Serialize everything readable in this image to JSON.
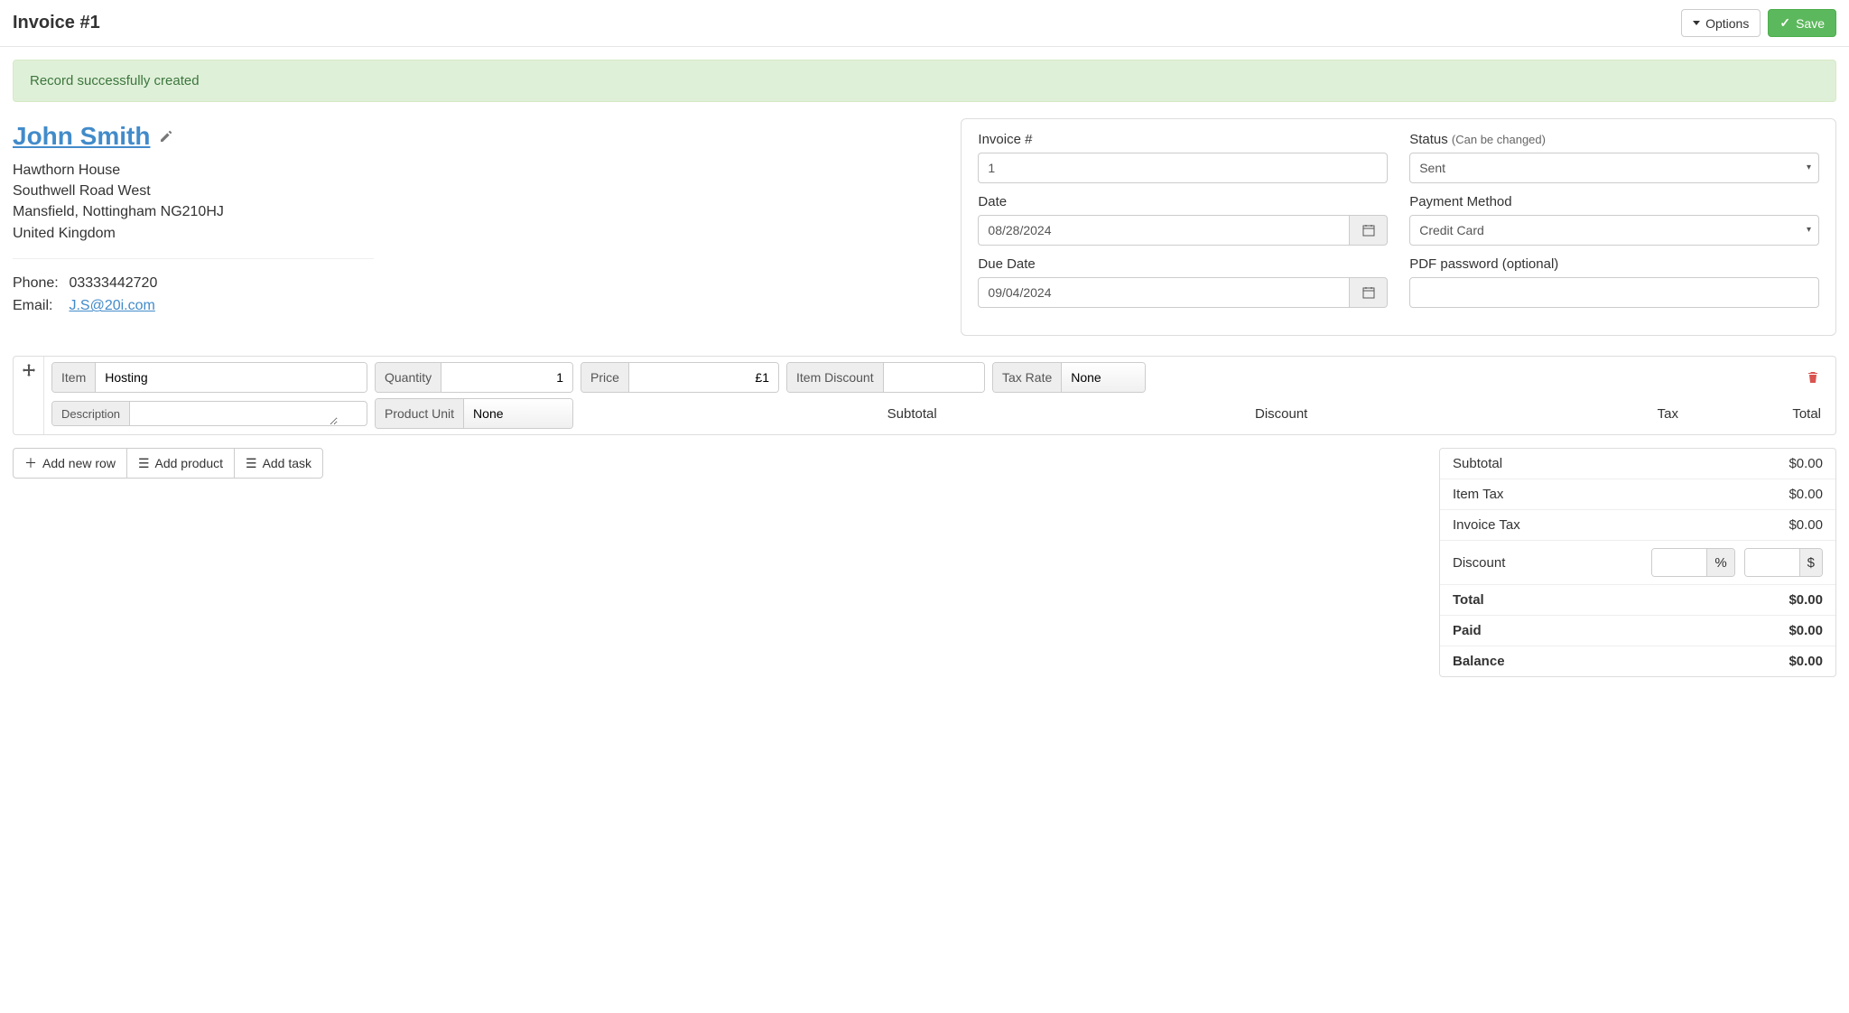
{
  "header": {
    "title": "Invoice #1",
    "options_label": "Options",
    "save_label": "Save"
  },
  "alert": {
    "message": "Record successfully created"
  },
  "customer": {
    "name": "John Smith",
    "address_line1": "Hawthorn House",
    "address_line2": "Southwell Road West",
    "address_line3": "Mansfield, Nottingham NG210HJ",
    "address_line4": "United Kingdom",
    "phone_label": "Phone:",
    "phone": "03333442720",
    "email_label": "Email:",
    "email": "J.S@20i.com"
  },
  "panel": {
    "invoice_number_label": "Invoice #",
    "invoice_number_value": "1",
    "date_label": "Date",
    "date_value": "08/28/2024",
    "due_date_label": "Due Date",
    "due_date_value": "09/04/2024",
    "status_label": "Status",
    "status_hint": "(Can be changed)",
    "status_value": "Sent",
    "payment_method_label": "Payment Method",
    "payment_method_value": "Credit Card",
    "pdf_password_label": "PDF password (optional)",
    "pdf_password_value": ""
  },
  "line": {
    "item_label": "Item",
    "item_value": "Hosting",
    "quantity_label": "Quantity",
    "quantity_value": "1",
    "price_label": "Price",
    "price_value": "£1",
    "item_discount_label": "Item Discount",
    "item_discount_value": "",
    "tax_rate_label": "Tax Rate",
    "tax_rate_value": "None",
    "description_label": "Description",
    "description_value": "",
    "product_unit_label": "Product Unit",
    "product_unit_value": "None",
    "subtotal_label": "Subtotal",
    "discount_label": "Discount",
    "tax_label": "Tax",
    "total_label": "Total"
  },
  "add": {
    "row": "Add new row",
    "product": "Add product",
    "task": "Add task"
  },
  "totals": {
    "subtotal_label": "Subtotal",
    "subtotal_value": "$0.00",
    "item_tax_label": "Item Tax",
    "item_tax_value": "$0.00",
    "invoice_tax_label": "Invoice Tax",
    "invoice_tax_value": "$0.00",
    "discount_label": "Discount",
    "discount_pct_suffix": "%",
    "discount_amt_suffix": "$",
    "total_label": "Total",
    "total_value": "$0.00",
    "paid_label": "Paid",
    "paid_value": "$0.00",
    "balance_label": "Balance",
    "balance_value": "$0.00"
  }
}
